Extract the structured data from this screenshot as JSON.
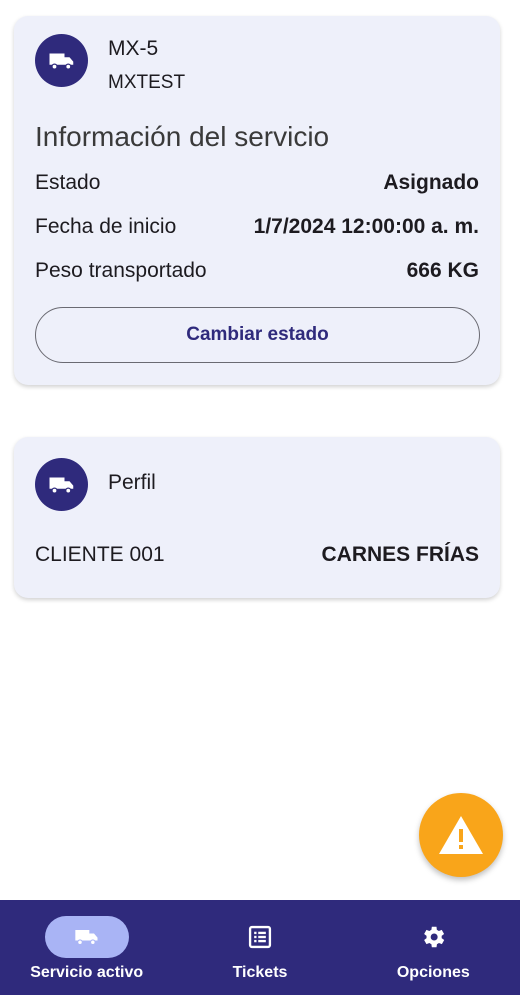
{
  "service_card": {
    "avatar_icon": "truck-icon",
    "unit": "MX-5",
    "company": "MXTEST",
    "section_title": "Información del servicio",
    "rows": [
      {
        "label": "Estado",
        "value": "Asignado"
      },
      {
        "label": "Fecha de inicio",
        "value": "1/7/2024 12:00:00 a. m."
      },
      {
        "label": "Peso transportado",
        "value": "666 KG"
      }
    ],
    "change_status_label": "Cambiar estado"
  },
  "profile_card": {
    "avatar_icon": "truck-icon",
    "title": "Perfil",
    "client_label": "CLIENTE 001",
    "client_value": "CARNES FRÍAS"
  },
  "fab": {
    "icon": "warning-icon",
    "color": "#f9a51a"
  },
  "bottom_nav": {
    "items": [
      {
        "label": "Servicio activo",
        "icon": "truck-icon",
        "active": true
      },
      {
        "label": "Tickets",
        "icon": "list-icon",
        "active": false
      },
      {
        "label": "Opciones",
        "icon": "gear-icon",
        "active": false
      }
    ]
  },
  "colors": {
    "primary": "#2f2a7c",
    "card_bg": "#eef0fa",
    "active_pill": "#a9b4f5",
    "warning": "#f9a51a"
  }
}
